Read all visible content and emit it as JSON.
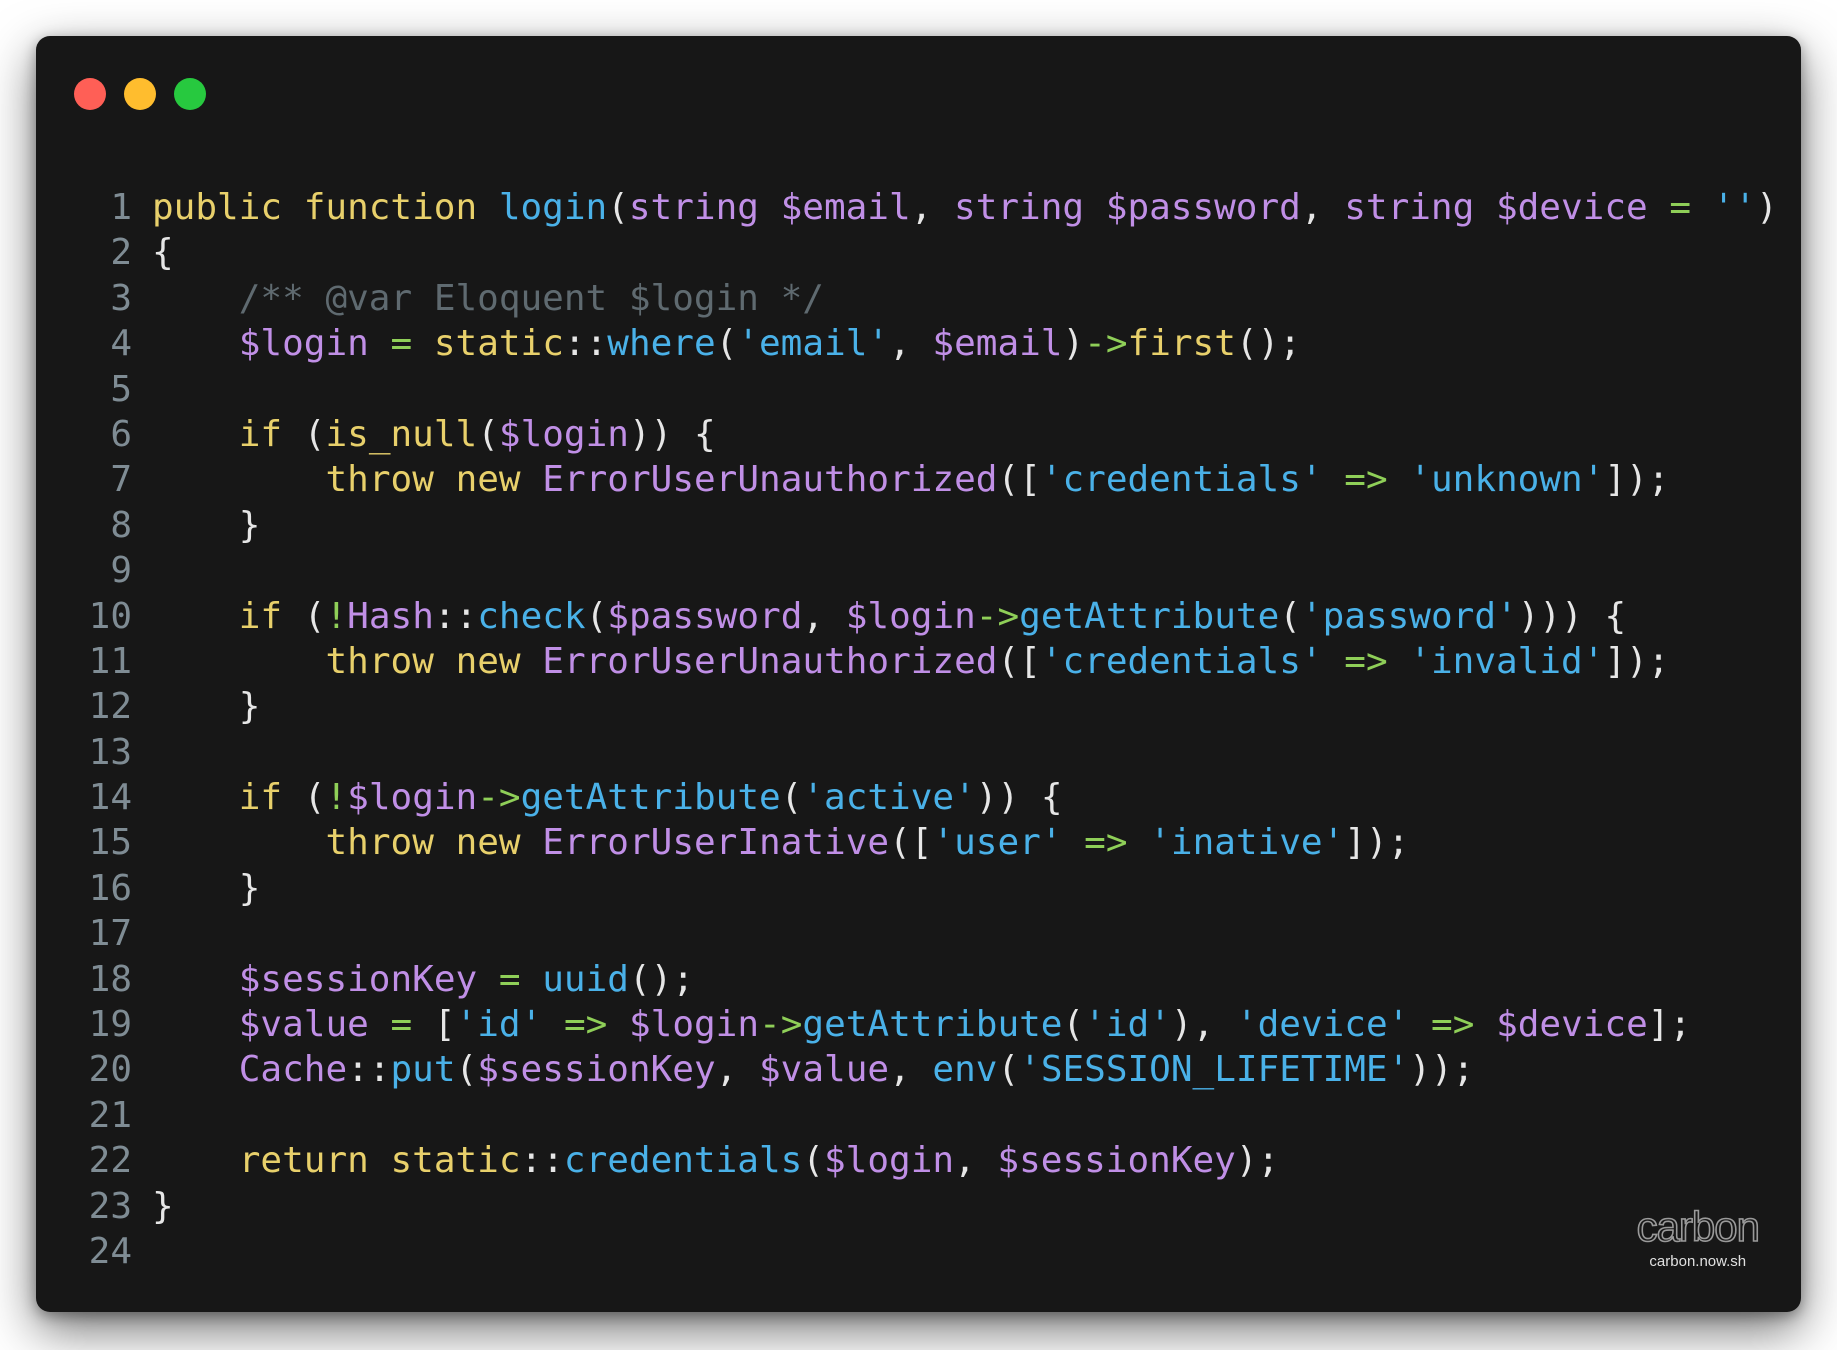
{
  "window": {
    "controls": [
      "close",
      "minimize",
      "zoom"
    ],
    "colors": {
      "background": "#171717",
      "close": "#ff5f56",
      "minimize": "#ffbd2e",
      "zoom": "#27c93f"
    }
  },
  "editor": {
    "language": "php",
    "lines": [
      {
        "number": "1",
        "text": "public function login(string $email, string $password, string $device = '')"
      },
      {
        "number": "2",
        "text": "{"
      },
      {
        "number": "3",
        "text": "    /** @var Eloquent $login */"
      },
      {
        "number": "4",
        "text": "    $login = static::where('email', $email)->first();"
      },
      {
        "number": "5",
        "text": ""
      },
      {
        "number": "6",
        "text": "    if (is_null($login)) {"
      },
      {
        "number": "7",
        "text": "        throw new ErrorUserUnauthorized(['credentials' => 'unknown']);"
      },
      {
        "number": "8",
        "text": "    }"
      },
      {
        "number": "9",
        "text": ""
      },
      {
        "number": "10",
        "text": "    if (!Hash::check($password, $login->getAttribute('password'))) {"
      },
      {
        "number": "11",
        "text": "        throw new ErrorUserUnauthorized(['credentials' => 'invalid']);"
      },
      {
        "number": "12",
        "text": "    }"
      },
      {
        "number": "13",
        "text": ""
      },
      {
        "number": "14",
        "text": "    if (!$login->getAttribute('active')) {"
      },
      {
        "number": "15",
        "text": "        throw new ErrorUserInative(['user' => 'inative']);"
      },
      {
        "number": "16",
        "text": "    }"
      },
      {
        "number": "17",
        "text": ""
      },
      {
        "number": "18",
        "text": "    $sessionKey = uuid();"
      },
      {
        "number": "19",
        "text": "    $value = ['id' => $login->getAttribute('id'), 'device' => $device];"
      },
      {
        "number": "20",
        "text": "    Cache::put($sessionKey, $value, env('SESSION_LIFETIME'));"
      },
      {
        "number": "21",
        "text": ""
      },
      {
        "number": "22",
        "text": "    return static::credentials($login, $sessionKey);"
      },
      {
        "number": "23",
        "text": "}"
      },
      {
        "number": "24",
        "text": ""
      }
    ]
  },
  "watermark": {
    "logo": "carbon",
    "url": "carbon.now.sh"
  }
}
